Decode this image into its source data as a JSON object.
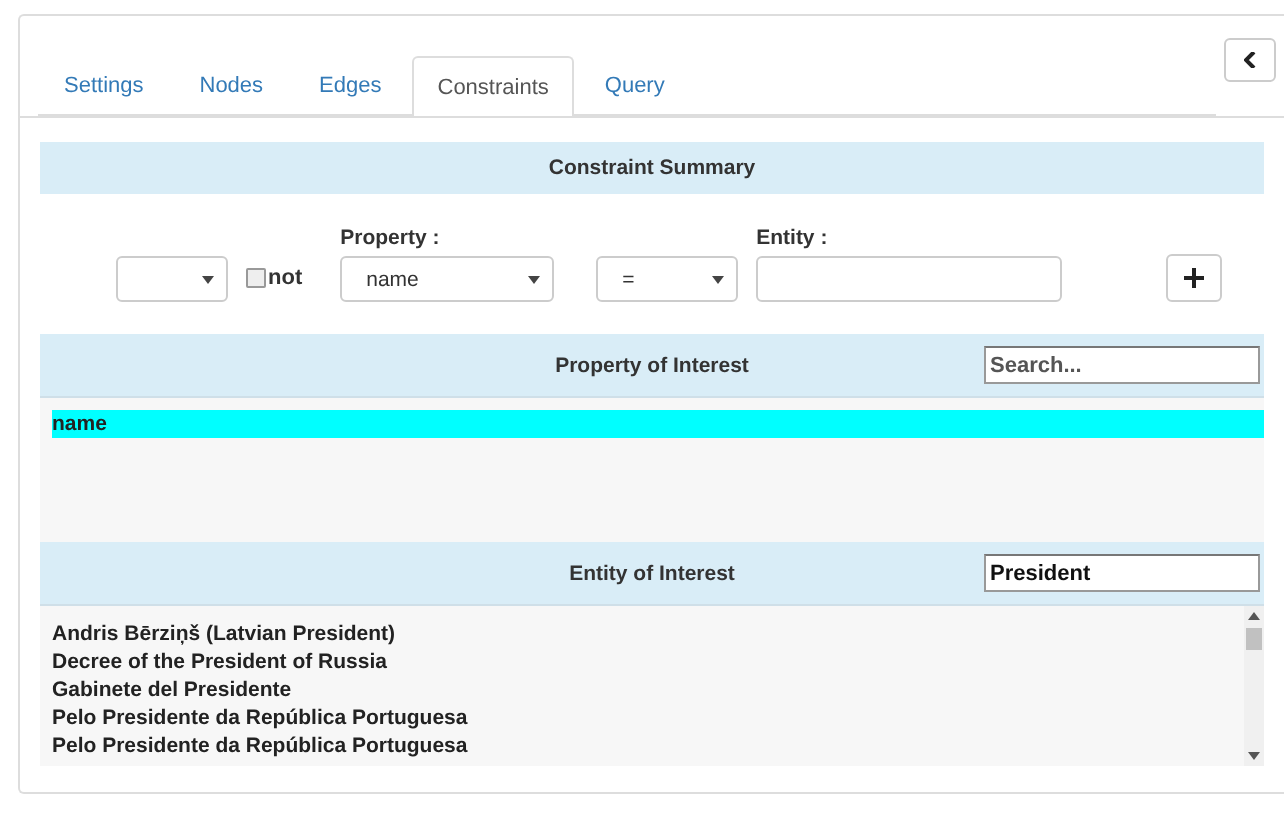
{
  "tabs": [
    {
      "label": "Settings",
      "selected": false
    },
    {
      "label": "Nodes",
      "selected": false
    },
    {
      "label": "Edges",
      "selected": false
    },
    {
      "label": "Constraints",
      "selected": true
    },
    {
      "label": "Query",
      "selected": false
    }
  ],
  "constraint_summary": {
    "title": "Constraint Summary"
  },
  "constraint_form": {
    "not_checkbox": {
      "label": "not",
      "checked": false
    },
    "property": {
      "label": "Property :",
      "value": "name"
    },
    "operator": {
      "value": "="
    },
    "entity": {
      "label": "Entity :"
    }
  },
  "property_panel": {
    "title": "Property of Interest",
    "search": {
      "placeholder": "Search..."
    },
    "items": [
      {
        "label": "name",
        "selected": true
      }
    ]
  },
  "entity_panel": {
    "title": "Entity of Interest",
    "search": {
      "value": "President"
    },
    "items": [
      {
        "label": "Andris Bērziņš (Latvian President)",
        "selected": false
      },
      {
        "label": "Decree of the President of Russia",
        "selected": false
      },
      {
        "label": "Gabinete del Presidente",
        "selected": false
      },
      {
        "label": "Pelo Presidente da República Portuguesa",
        "selected": false
      },
      {
        "label": "Pelo Presidente da República Portuguesa",
        "selected": false
      }
    ]
  }
}
